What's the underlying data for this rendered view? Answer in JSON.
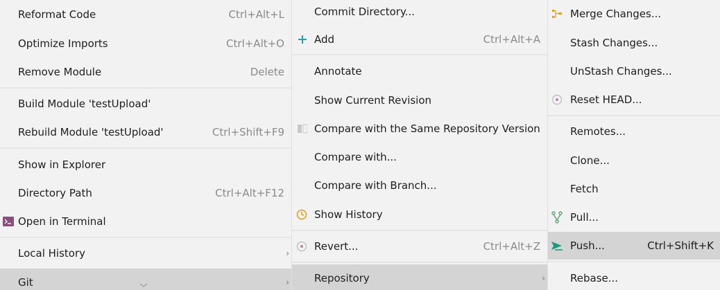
{
  "menu1": {
    "items": [
      {
        "label": "Reformat Code",
        "shortcut": "Ctrl+Alt+L"
      },
      {
        "label": "Optimize Imports",
        "shortcut": "Ctrl+Alt+O"
      },
      {
        "label": "Remove Module",
        "shortcut": "Delete"
      },
      {
        "label": "Build Module 'testUpload'",
        "shortcut": ""
      },
      {
        "label": "Rebuild Module 'testUpload'",
        "shortcut": "Ctrl+Shift+F9"
      },
      {
        "label": "Show in Explorer",
        "shortcut": ""
      },
      {
        "label": "Directory Path",
        "shortcut": "Ctrl+Alt+F12"
      },
      {
        "label": "Open in Terminal",
        "shortcut": ""
      },
      {
        "label": "Local History",
        "shortcut": ""
      },
      {
        "label": "Git",
        "shortcut": ""
      }
    ]
  },
  "menu2": {
    "items": [
      {
        "label": "Commit Directory...",
        "shortcut": ""
      },
      {
        "label": "Add",
        "shortcut": "Ctrl+Alt+A"
      },
      {
        "label": "Annotate",
        "shortcut": ""
      },
      {
        "label": "Show Current Revision",
        "shortcut": ""
      },
      {
        "label": "Compare with the Same Repository Version",
        "shortcut": ""
      },
      {
        "label": "Compare with...",
        "shortcut": ""
      },
      {
        "label": "Compare with Branch...",
        "shortcut": ""
      },
      {
        "label": "Show History",
        "shortcut": ""
      },
      {
        "label": "Revert...",
        "shortcut": "Ctrl+Alt+Z"
      },
      {
        "label": "Repository",
        "shortcut": ""
      }
    ]
  },
  "menu3": {
    "items": [
      {
        "label": "Merge Changes...",
        "shortcut": ""
      },
      {
        "label": "Stash Changes...",
        "shortcut": ""
      },
      {
        "label": "UnStash Changes...",
        "shortcut": ""
      },
      {
        "label": "Reset HEAD...",
        "shortcut": ""
      },
      {
        "label": "Remotes...",
        "shortcut": ""
      },
      {
        "label": "Clone...",
        "shortcut": ""
      },
      {
        "label": "Fetch",
        "shortcut": ""
      },
      {
        "label": "Pull...",
        "shortcut": ""
      },
      {
        "label": "Push...",
        "shortcut": "Ctrl+Shift+K"
      },
      {
        "label": "Rebase...",
        "shortcut": ""
      }
    ]
  },
  "arrow_glyph": "›",
  "colors": {
    "selected_bg": "#d4d4d4",
    "add_icon": "#2aa1b3",
    "history_icon": "#e0a020",
    "push_icon": "#1d9a7e",
    "terminal_icon": "#8b4d7e",
    "merge_icon": "#e0a020",
    "pull_icon": "#5aa36c"
  }
}
